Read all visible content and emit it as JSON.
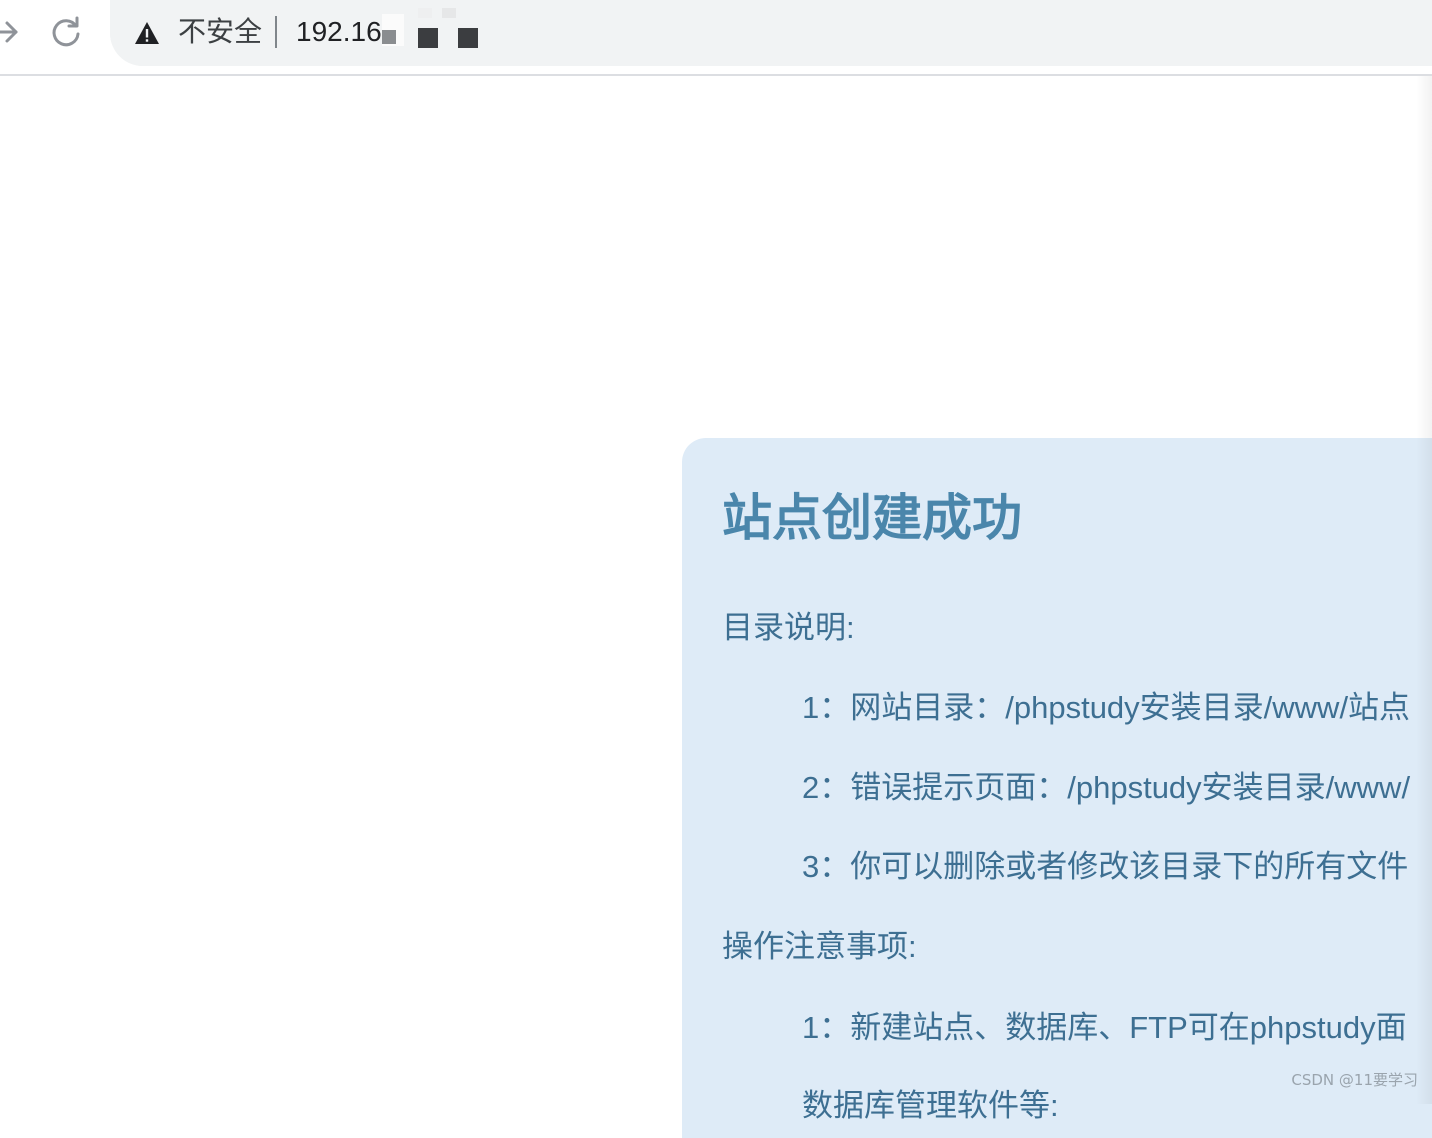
{
  "browser": {
    "omnibox": {
      "security_label": "不安全",
      "url_text": "192.16"
    },
    "icons": {
      "forward": "forward-arrow-icon",
      "reload": "reload-icon",
      "security": "warning-triangle-icon"
    }
  },
  "page": {
    "title": "站点创建成功",
    "directory_heading": "目录说明:",
    "directory_items": [
      "1：网站目录：/phpstudy安装目录/www/站点",
      "2：错误提示页面：/phpstudy安装目录/www/",
      "3：你可以删除或者修改该目录下的所有文件"
    ],
    "notes_heading": "操作注意事项:",
    "notes_items": [
      "1：新建站点、数据库、FTP可在phpstudy面",
      "数据库管理软件等:"
    ]
  },
  "watermark": "CSDN @11要学习",
  "colors": {
    "panel_background": "#deebf7",
    "title_color": "#4a86ab",
    "text_color": "#3d6f92",
    "omnibox_background": "#f1f3f4"
  }
}
